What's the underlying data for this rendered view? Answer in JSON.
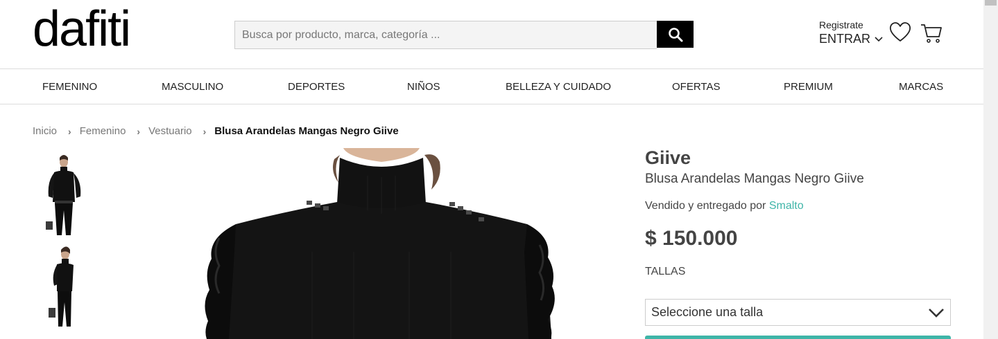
{
  "header": {
    "logo_text": "dafiti",
    "search_placeholder": "Busca por producto, marca, categoría ...",
    "register_label": "Registrate",
    "login_label": "ENTRAR"
  },
  "nav": {
    "items": [
      "FEMENINO",
      "MASCULINO",
      "DEPORTES",
      "NIÑOS",
      "BELLEZA Y CUIDADO",
      "OFERTAS",
      "PREMIUM",
      "MARCAS"
    ]
  },
  "breadcrumb": {
    "items": [
      "Inicio",
      "Femenino",
      "Vestuario"
    ],
    "current": "Blusa Arandelas Mangas Negro Giive",
    "separator": "›"
  },
  "product": {
    "brand": "Giive",
    "name": "Blusa Arandelas Mangas Negro Giive",
    "seller_prefix": "Vendido y entregado por",
    "seller_name": "Smalto",
    "price": "$ 150.000",
    "sizes_label": "TALLAS",
    "size_select_placeholder": "Seleccione una talla"
  },
  "colors": {
    "accent": "#3fb5a8",
    "text": "#444444",
    "black": "#000000"
  },
  "icons": {
    "search": "search-icon",
    "heart": "heart-icon",
    "cart": "cart-icon",
    "chevron": "chevron-down-icon"
  }
}
